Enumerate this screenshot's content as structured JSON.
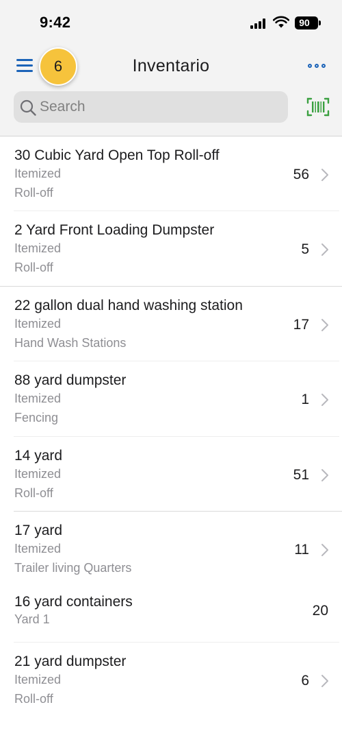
{
  "status_bar": {
    "time": "9:42",
    "battery": "90"
  },
  "header": {
    "title": "Inventario",
    "badge_count": "6"
  },
  "search": {
    "placeholder": "Search",
    "value": ""
  },
  "colors": {
    "accent": "#1b63b8",
    "badge": "#f6c33c",
    "scan": "#3aa040"
  },
  "icons": [
    "menu-icon",
    "more-icon",
    "search-icon",
    "barcode-icon",
    "chevron-right-icon"
  ],
  "items": [
    {
      "name": "30 Cubic Yard Open Top Roll-off",
      "type": "Itemized",
      "category": "Roll-off",
      "qty": "56",
      "chevron": true
    },
    {
      "name": "2 Yard Front Loading Dumpster",
      "type": "Itemized",
      "category": "Roll-off",
      "qty": "5",
      "chevron": true
    },
    {
      "name": "22 gallon dual hand washing station",
      "type": "Itemized",
      "category": "Hand Wash Stations",
      "qty": "17",
      "chevron": true
    },
    {
      "name": "88 yard dumpster",
      "type": "Itemized",
      "category": "Fencing",
      "qty": "1",
      "chevron": true
    },
    {
      "name": "14 yard",
      "type": "Itemized",
      "category": "Roll-off",
      "qty": "51",
      "chevron": true
    },
    {
      "name": "17 yard",
      "type": "Itemized",
      "category": "Trailer living Quarters",
      "qty": "11",
      "chevron": true
    },
    {
      "name": "16 yard containers",
      "type": "Yard 1",
      "category": "",
      "qty": "20",
      "chevron": false
    },
    {
      "name": "21 yard dumpster",
      "type": "Itemized",
      "category": "Roll-off",
      "qty": "6",
      "chevron": true
    }
  ]
}
